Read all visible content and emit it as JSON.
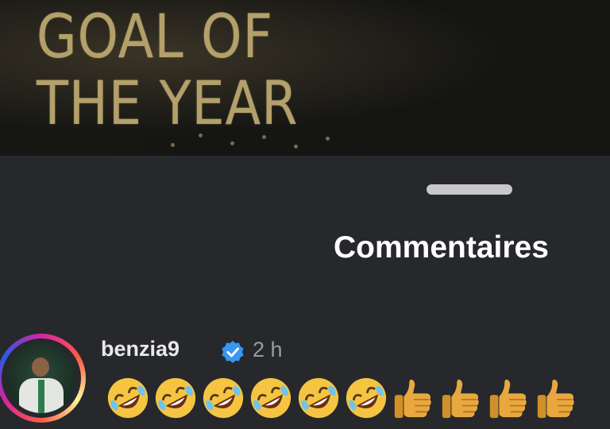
{
  "banner": {
    "title_line1": "GOAL OF",
    "title_line2": "THE YEAR"
  },
  "sheet": {
    "title": "Commentaires"
  },
  "comment": {
    "username": "benzia9",
    "verified": true,
    "time": "2 h",
    "emojis": [
      "rolling-on-floor-laughing",
      "rolling-on-floor-laughing",
      "rolling-on-floor-laughing",
      "rolling-on-floor-laughing",
      "rolling-on-floor-laughing",
      "rolling-on-floor-laughing",
      "thumbs-up",
      "thumbs-up",
      "thumbs-up",
      "thumbs-up"
    ]
  },
  "colors": {
    "background": "#26282c",
    "banner_gold": "#b3a06a",
    "verified_blue": "#3897f0",
    "emoji_yellow": "#f5c542",
    "thumb_skin": "#e8a83f"
  }
}
